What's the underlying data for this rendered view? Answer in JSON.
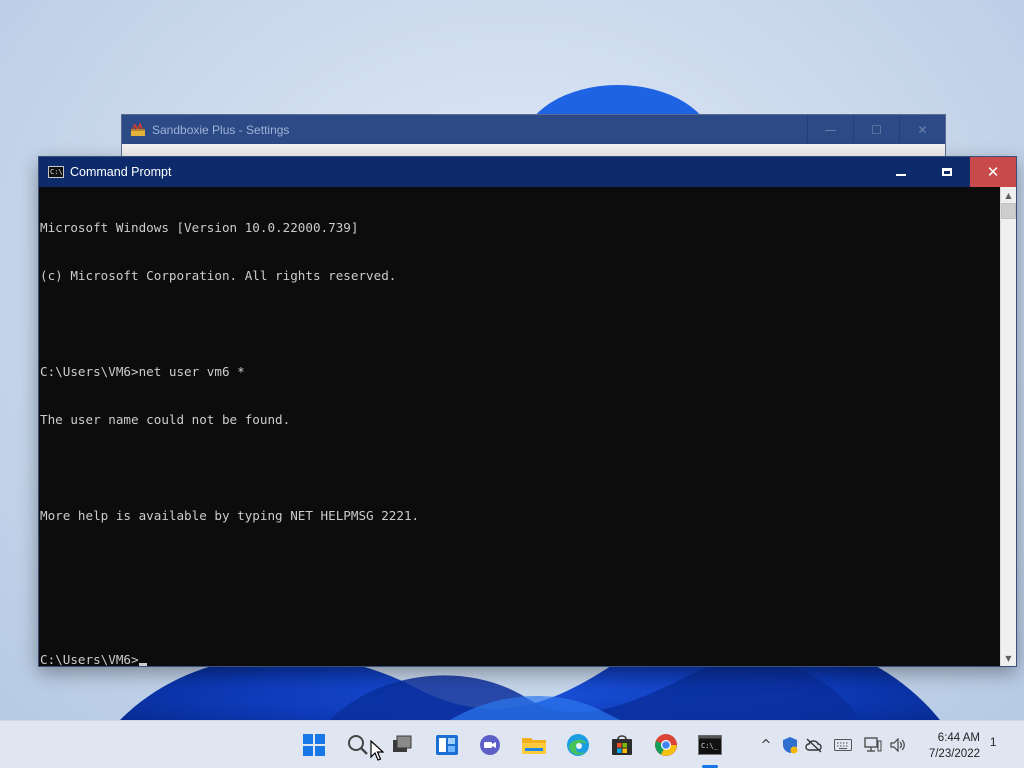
{
  "background_window": {
    "title": "Sandboxie Plus - Settings",
    "controls": {
      "minimize": "—",
      "maximize": "☐",
      "close": "✕"
    }
  },
  "cmd": {
    "title": "Command Prompt",
    "lines": [
      "Microsoft Windows [Version 10.0.22000.739]",
      "(c) Microsoft Corporation. All rights reserved.",
      "",
      "C:\\Users\\VM6>net user vm6 *",
      "The user name could not be found.",
      "",
      "More help is available by typing NET HELPMSG 2221.",
      "",
      ""
    ],
    "prompt": "C:\\Users\\VM6>",
    "controls": {
      "close": "✕"
    }
  },
  "taskbar": {
    "icons": [
      "windows-start-icon",
      "search-icon",
      "task-view-icon",
      "widgets-icon",
      "chat-icon",
      "file-explorer-icon",
      "edge-icon",
      "store-icon",
      "chrome-icon",
      "command-prompt-icon"
    ],
    "tray": {
      "overflow_chevron": "^",
      "clock_time": "6:44 AM",
      "clock_date": "7/23/2022",
      "notification_count": "1"
    }
  },
  "colors": {
    "cmd_titlebar": "#0d2a6b",
    "close_button": "#c94a4a",
    "console_bg": "#0c0c0c",
    "console_text": "#cccccc"
  }
}
